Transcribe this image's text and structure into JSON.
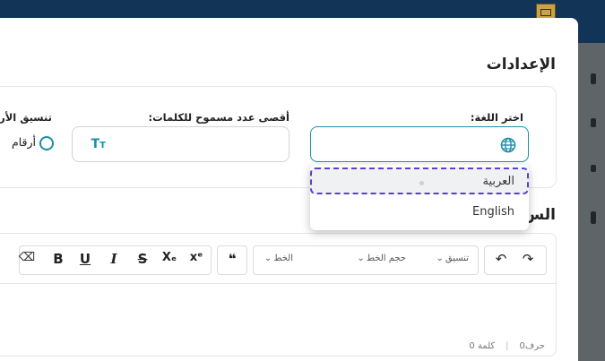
{
  "settings": {
    "section_title": "الإعدادات",
    "language_label": "اختر اللغة:",
    "max_words_label": "أقصى عدد مسموح للكلمات:",
    "format_label": "تنسيق الأر",
    "radio_label": "أرقام",
    "language_icon": "globe-icon",
    "max_words_icon": "text-size-icon"
  },
  "language_dropdown": {
    "options": [
      "العربية",
      "English"
    ],
    "highlighted": "العربية"
  },
  "editor": {
    "title": "الس",
    "toolbar": {
      "undo": "↶",
      "redo": "↷",
      "format_dropdown": "تنسيق",
      "font_size_dropdown": "حجم الخط",
      "font_dropdown": "الخط",
      "quote": "❝",
      "superscript": "xᵉ",
      "subscript": "Xₑ",
      "strikethrough": "S",
      "italic": "I",
      "underline": "U",
      "bold": "B",
      "eraser": "⌫"
    },
    "char_count": "حرف0",
    "word_count": "كلمة 0"
  },
  "colors": {
    "accent": "#1d8ea8",
    "header": "#123457",
    "focus_outline": "#5b3fd4"
  }
}
